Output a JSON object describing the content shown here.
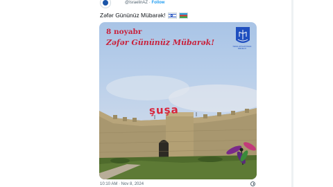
{
  "tweet": {
    "handle": "@IsraelinAZ",
    "separator": "·",
    "follow_label": "Follow",
    "text": "Zəfər Gününüz Mübarək!",
    "flags": [
      "israel-flag-icon",
      "azerbaijan-flag-icon"
    ],
    "timestamp": "10:10 AM · Nov 8, 2024"
  },
  "media": {
    "title_line1": "8 noyabr",
    "title_line2": "Zəfər Gününüz Mübarək!",
    "sign_text": "şuşa",
    "emblem_text": "İSRAİL DÖVLƏTİ BAKI SƏFİRLİYİ",
    "colors": {
      "title": "#c8233d",
      "sign": "#d8233a",
      "emblem": "#1f4fbf"
    }
  }
}
